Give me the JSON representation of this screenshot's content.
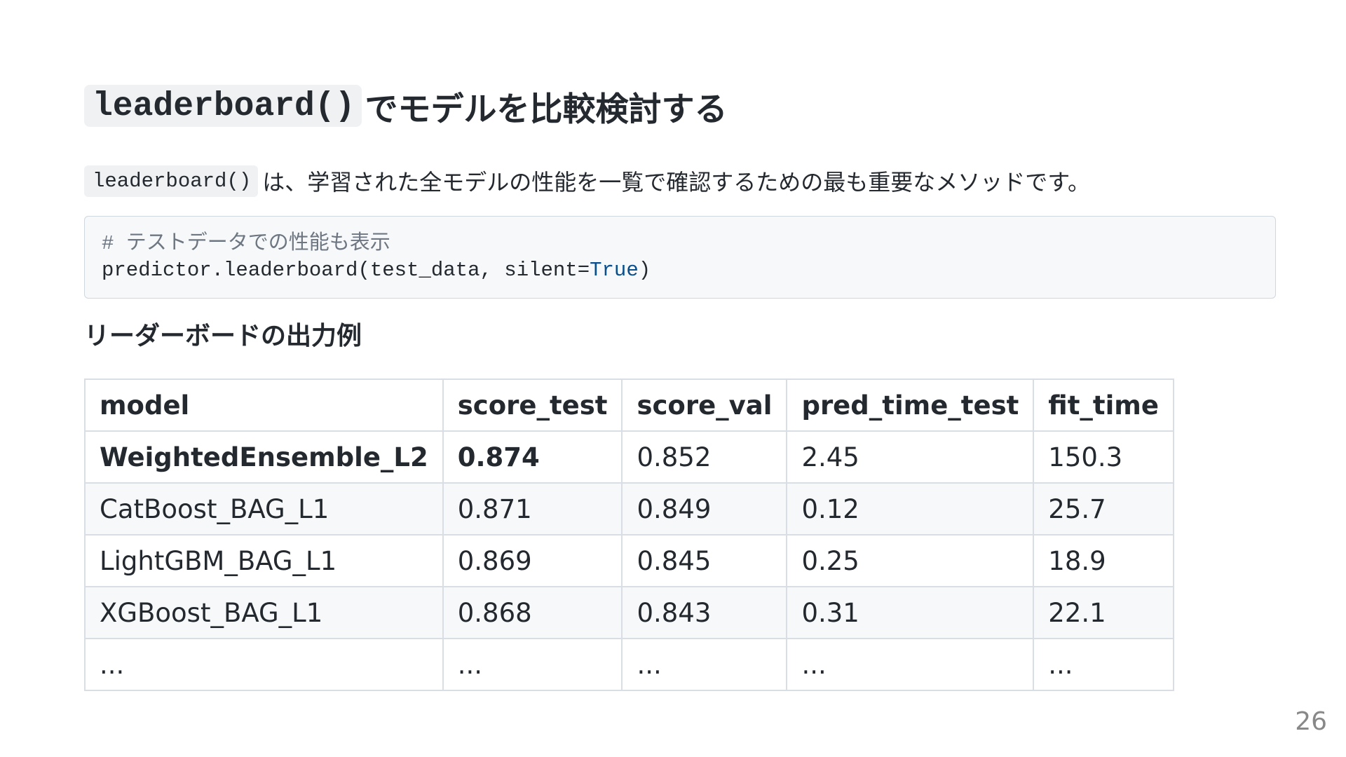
{
  "title": {
    "code": "leaderboard()",
    "text": "でモデルを比較検討する"
  },
  "lead": {
    "code": "leaderboard()",
    "text": "は、学習された全モデルの性能を一覧で確認するための最も重要なメソッドです。"
  },
  "code_block": {
    "comment": "# テストデータでの性能も表示",
    "code_prefix": "predictor.leaderboard(test_data, silent=",
    "code_keyword": "True",
    "code_suffix": ")"
  },
  "subtitle": "リーダーボードの出力例",
  "table": {
    "headers": [
      "model",
      "score_test",
      "score_val",
      "pred_time_test",
      "fit_time"
    ],
    "rows": [
      [
        "WeightedEnsemble_L2",
        "0.874",
        "0.852",
        "2.45",
        "150.3"
      ],
      [
        "CatBoost_BAG_L1",
        "0.871",
        "0.849",
        "0.12",
        "25.7"
      ],
      [
        "LightGBM_BAG_L1",
        "0.869",
        "0.845",
        "0.25",
        "18.9"
      ],
      [
        "XGBoost_BAG_L1",
        "0.868",
        "0.843",
        "0.31",
        "22.1"
      ],
      [
        "...",
        "...",
        "...",
        "...",
        "..."
      ]
    ]
  },
  "page_number": "26"
}
